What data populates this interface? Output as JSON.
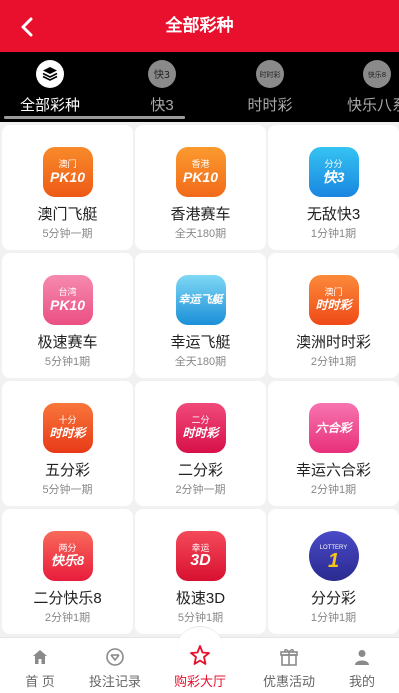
{
  "header": {
    "title": "全部彩种"
  },
  "tabs": [
    {
      "label": "全部彩种",
      "icon": "layers-icon"
    },
    {
      "label": "快3",
      "icon": "k3-logo-icon"
    },
    {
      "label": "时时彩",
      "icon": "ssc-logo-icon"
    },
    {
      "label": "快乐八系",
      "icon": "kl8-logo-icon"
    }
  ],
  "games": [
    {
      "name": "澳门飞艇",
      "schedule": "5分钟一期",
      "icon_top": "澳门",
      "icon_main": "PK10",
      "color": "#f26a1f"
    },
    {
      "name": "香港赛车",
      "schedule": "全天180期",
      "icon_top": "香港",
      "icon_main": "PK10",
      "color": "#f5761e"
    },
    {
      "name": "无敌快3",
      "schedule": "1分钟1期",
      "icon_top": "分分",
      "icon_main": "快3",
      "color": "#1e9ee8"
    },
    {
      "name": "极速赛车",
      "schedule": "5分钟1期",
      "icon_top": "台湾",
      "icon_main": "PK10",
      "color": "#f15a8c"
    },
    {
      "name": "幸运飞艇",
      "schedule": "全天180期",
      "icon_top": "",
      "icon_main": "幸运飞艇",
      "color": "#1ea3e0"
    },
    {
      "name": "澳洲时时彩",
      "schedule": "2分钟1期",
      "icon_top": "澳门",
      "icon_main": "时时彩",
      "color": "#f55a1e"
    },
    {
      "name": "五分彩",
      "schedule": "5分钟一期",
      "icon_top": "十分",
      "icon_main": "时时彩",
      "color": "#f04d1e"
    },
    {
      "name": "二分彩",
      "schedule": "2分钟一期",
      "icon_top": "二分",
      "icon_main": "时时彩",
      "color": "#e4185a"
    },
    {
      "name": "幸运六合彩",
      "schedule": "2分钟1期",
      "icon_top": "",
      "icon_main": "六合彩",
      "color": "#ef3a8c"
    },
    {
      "name": "二分快乐8",
      "schedule": "2分钟1期",
      "icon_top": "两分",
      "icon_main": "快乐8",
      "color": "#ef2c4a"
    },
    {
      "name": "极速3D",
      "schedule": "5分钟1期",
      "icon_top": "幸运",
      "icon_main": "3D",
      "color": "#e8203c"
    },
    {
      "name": "分分彩",
      "schedule": "1分钟1期",
      "icon_top": "LOTTERY",
      "icon_main": "1",
      "color": "#3a3aa8"
    }
  ],
  "bottom_nav": [
    {
      "label": "首 页",
      "icon": "home-icon"
    },
    {
      "label": "投注记录",
      "icon": "bet-record-icon"
    },
    {
      "label": "购彩大厅",
      "icon": "lottery-hall-icon"
    },
    {
      "label": "优惠活动",
      "icon": "gift-icon"
    },
    {
      "label": "我的",
      "icon": "user-icon"
    }
  ],
  "colors": {
    "brand": "#e8102d",
    "tab_bg": "#000000",
    "page_bg": "#f1f1f1"
  }
}
